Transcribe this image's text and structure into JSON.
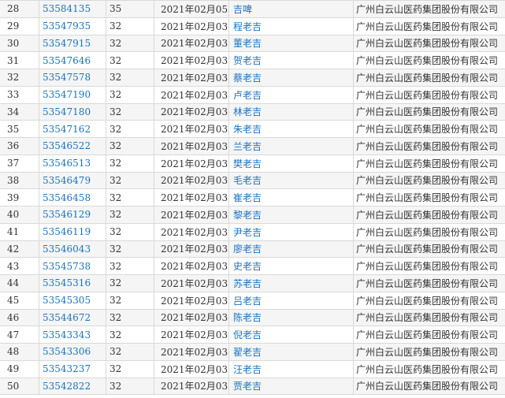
{
  "table": {
    "rows": [
      {
        "idx": "28",
        "reg": "53584135",
        "cls": "35",
        "date": "2021年02月05日",
        "name": "吉啤",
        "applicant": "广州白云山医药集团股份有限公司"
      },
      {
        "idx": "29",
        "reg": "53547935",
        "cls": "32",
        "date": "2021年02月03日",
        "name": "程老吉",
        "applicant": "广州白云山医药集团股份有限公司"
      },
      {
        "idx": "30",
        "reg": "53547915",
        "cls": "32",
        "date": "2021年02月03日",
        "name": "董老吉",
        "applicant": "广州白云山医药集团股份有限公司"
      },
      {
        "idx": "31",
        "reg": "53547646",
        "cls": "32",
        "date": "2021年02月03日",
        "name": "贺老吉",
        "applicant": "广州白云山医药集团股份有限公司"
      },
      {
        "idx": "32",
        "reg": "53547578",
        "cls": "32",
        "date": "2021年02月03日",
        "name": "蔡老吉",
        "applicant": "广州白云山医药集团股份有限公司"
      },
      {
        "idx": "33",
        "reg": "53547190",
        "cls": "32",
        "date": "2021年02月03日",
        "name": "卢老吉",
        "applicant": "广州白云山医药集团股份有限公司"
      },
      {
        "idx": "34",
        "reg": "53547180",
        "cls": "32",
        "date": "2021年02月03日",
        "name": "林老吉",
        "applicant": "广州白云山医药集团股份有限公司"
      },
      {
        "idx": "35",
        "reg": "53547162",
        "cls": "32",
        "date": "2021年02月03日",
        "name": "朱老吉",
        "applicant": "广州白云山医药集团股份有限公司"
      },
      {
        "idx": "36",
        "reg": "53546522",
        "cls": "32",
        "date": "2021年02月03日",
        "name": "兰老吉",
        "applicant": "广州白云山医药集团股份有限公司"
      },
      {
        "idx": "37",
        "reg": "53546513",
        "cls": "32",
        "date": "2021年02月03日",
        "name": "樊老吉",
        "applicant": "广州白云山医药集团股份有限公司"
      },
      {
        "idx": "38",
        "reg": "53546479",
        "cls": "32",
        "date": "2021年02月03日",
        "name": "毛老吉",
        "applicant": "广州白云山医药集团股份有限公司"
      },
      {
        "idx": "39",
        "reg": "53546458",
        "cls": "32",
        "date": "2021年02月03日",
        "name": "崔老吉",
        "applicant": "广州白云山医药集团股份有限公司"
      },
      {
        "idx": "40",
        "reg": "53546129",
        "cls": "32",
        "date": "2021年02月03日",
        "name": "黎老吉",
        "applicant": "广州白云山医药集团股份有限公司"
      },
      {
        "idx": "41",
        "reg": "53546119",
        "cls": "32",
        "date": "2021年02月03日",
        "name": "尹老吉",
        "applicant": "广州白云山医药集团股份有限公司"
      },
      {
        "idx": "42",
        "reg": "53546043",
        "cls": "32",
        "date": "2021年02月03日",
        "name": "廖老吉",
        "applicant": "广州白云山医药集团股份有限公司"
      },
      {
        "idx": "43",
        "reg": "53545738",
        "cls": "32",
        "date": "2021年02月03日",
        "name": "史老吉",
        "applicant": "广州白云山医药集团股份有限公司"
      },
      {
        "idx": "44",
        "reg": "53545316",
        "cls": "32",
        "date": "2021年02月03日",
        "name": "苏老吉",
        "applicant": "广州白云山医药集团股份有限公司"
      },
      {
        "idx": "45",
        "reg": "53545305",
        "cls": "32",
        "date": "2021年02月03日",
        "name": "吕老吉",
        "applicant": "广州白云山医药集团股份有限公司"
      },
      {
        "idx": "46",
        "reg": "53544672",
        "cls": "32",
        "date": "2021年02月03日",
        "name": "陈老吉",
        "applicant": "广州白云山医药集团股份有限公司"
      },
      {
        "idx": "47",
        "reg": "53543343",
        "cls": "32",
        "date": "2021年02月03日",
        "name": "倪老吉",
        "applicant": "广州白云山医药集团股份有限公司"
      },
      {
        "idx": "48",
        "reg": "53543306",
        "cls": "32",
        "date": "2021年02月03日",
        "name": "翟老吉",
        "applicant": "广州白云山医药集团股份有限公司"
      },
      {
        "idx": "49",
        "reg": "53543237",
        "cls": "32",
        "date": "2021年02月03日",
        "name": "汪老吉",
        "applicant": "广州白云山医药集团股份有限公司"
      },
      {
        "idx": "50",
        "reg": "53542822",
        "cls": "32",
        "date": "2021年02月03日",
        "name": "贾老吉",
        "applicant": "广州白云山医药集团股份有限公司"
      }
    ]
  },
  "colors": {
    "link": "#1a73bf",
    "text": "#333333",
    "row_stripe": "#f5f5f5",
    "border": "#d9d9d9"
  }
}
